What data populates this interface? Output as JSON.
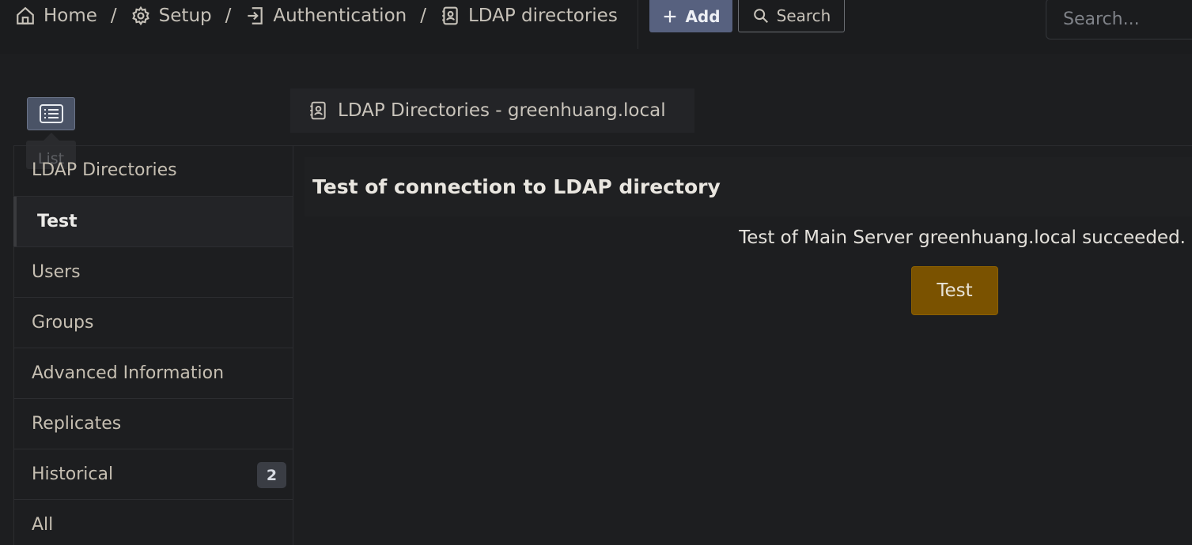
{
  "breadcrumb": {
    "home": "Home",
    "setup": "Setup",
    "authentication": "Authentication",
    "ldap": "LDAP directories",
    "separator": "/"
  },
  "toolbar": {
    "add_label": "Add",
    "search_label": "Search",
    "search_placeholder": "Search..."
  },
  "list_toggle": {
    "tooltip": "List"
  },
  "header": {
    "title": "LDAP Directories - greenhuang.local"
  },
  "sidebar": {
    "items": [
      {
        "label": "LDAP Directories"
      },
      {
        "label": "Test"
      },
      {
        "label": "Users"
      },
      {
        "label": "Groups"
      },
      {
        "label": "Advanced Information"
      },
      {
        "label": "Replicates"
      },
      {
        "label": "Historical",
        "badge": "2"
      },
      {
        "label": "All"
      }
    ]
  },
  "main": {
    "section_title": "Test of connection to LDAP directory",
    "result_message": "Test of Main Server greenhuang.local succeeded.",
    "test_button": "Test"
  },
  "colors": {
    "background": "#1d1e20",
    "add_button": "#57617f",
    "test_button": "#7a5200",
    "active_item": "#232427"
  }
}
